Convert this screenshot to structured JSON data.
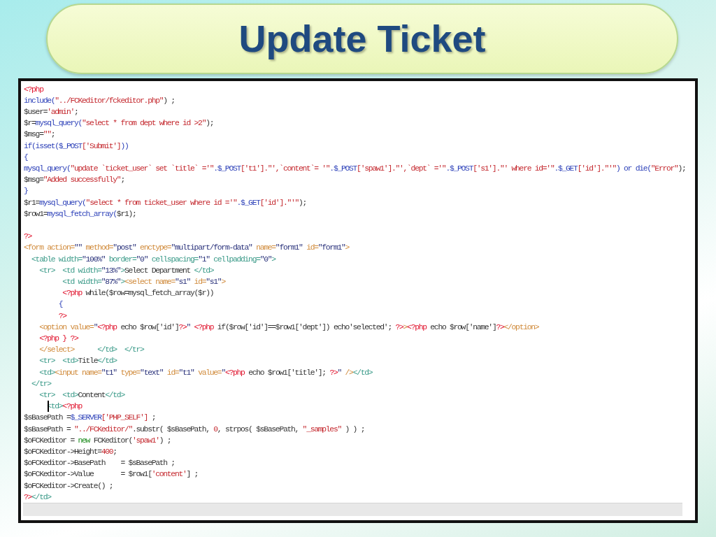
{
  "slide": {
    "title": "Update Ticket"
  },
  "code_lines": [
    {
      "segments": [
        {
          "text": "<?php",
          "kind": "php"
        }
      ]
    },
    {
      "segments": [
        {
          "text": "include(",
          "kind": "func"
        },
        {
          "text": "\"../FCKeditor/fckeditor.php\"",
          "kind": "string"
        },
        {
          "text": ") ;",
          "kind": "plain"
        }
      ]
    },
    {
      "segments": [
        {
          "text": "$user=",
          "kind": "plain"
        },
        {
          "text": "'admin'",
          "kind": "string"
        },
        {
          "text": ";",
          "kind": "plain"
        }
      ]
    },
    {
      "segments": [
        {
          "text": "$r=",
          "kind": "plain"
        },
        {
          "text": "mysql_query(",
          "kind": "func"
        },
        {
          "text": "\"select * from dept where id >2\"",
          "kind": "string"
        },
        {
          "text": ");",
          "kind": "plain"
        }
      ]
    },
    {
      "segments": [
        {
          "text": "$msg=",
          "kind": "plain"
        },
        {
          "text": "\"\"",
          "kind": "string"
        },
        {
          "text": ";",
          "kind": "plain"
        }
      ]
    },
    {
      "segments": [
        {
          "text": "if(isset(",
          "kind": "func"
        },
        {
          "text": "$_POST",
          "kind": "func"
        },
        {
          "text": "['Submit']",
          "kind": "string"
        },
        {
          "text": "))",
          "kind": "func"
        }
      ]
    },
    {
      "segments": [
        {
          "text": "{",
          "kind": "func"
        }
      ]
    },
    {
      "segments": [
        {
          "text": "mysql_query(",
          "kind": "func"
        },
        {
          "text": "\"update `ticket_user` set `title` ='\"",
          "kind": "string"
        },
        {
          "text": ".$_POST",
          "kind": "func"
        },
        {
          "text": "['t1'].\"',`content`= '\"",
          "kind": "string"
        },
        {
          "text": ".$_POST",
          "kind": "func"
        },
        {
          "text": "['spaw1'].\"',`dept` ='\"",
          "kind": "string"
        },
        {
          "text": ".$_POST",
          "kind": "func"
        },
        {
          "text": "['s1'].\"' where id='\"",
          "kind": "string"
        },
        {
          "text": ".$_GET",
          "kind": "func"
        },
        {
          "text": "['id'].\"'\"",
          "kind": "string"
        },
        {
          "text": ") or die(",
          "kind": "func"
        },
        {
          "text": "\"Error\"",
          "kind": "string"
        },
        {
          "text": ");",
          "kind": "plain"
        }
      ]
    },
    {
      "segments": [
        {
          "text": "$msg=",
          "kind": "plain"
        },
        {
          "text": "\"Added successfully\"",
          "kind": "string"
        },
        {
          "text": ";",
          "kind": "plain"
        }
      ]
    },
    {
      "segments": [
        {
          "text": "}",
          "kind": "func"
        }
      ]
    },
    {
      "segments": [
        {
          "text": "$r1=",
          "kind": "plain"
        },
        {
          "text": "mysql_query(",
          "kind": "func"
        },
        {
          "text": "\"select * from ticket_user where id ='\"",
          "kind": "string"
        },
        {
          "text": ".$_GET",
          "kind": "func"
        },
        {
          "text": "['id'].\"'\"",
          "kind": "string"
        },
        {
          "text": ");",
          "kind": "plain"
        }
      ]
    },
    {
      "segments": [
        {
          "text": "$row1=",
          "kind": "plain"
        },
        {
          "text": "mysql_fetch_array(",
          "kind": "func"
        },
        {
          "text": "$r1);",
          "kind": "plain"
        }
      ]
    },
    {
      "gap_before": true,
      "segments": [
        {
          "text": "?>",
          "kind": "php"
        }
      ]
    },
    {
      "segments": [
        {
          "text": "<form action=",
          "kind": "tag"
        },
        {
          "text": "\"\"",
          "kind": "value"
        },
        {
          "text": " method=",
          "kind": "tag"
        },
        {
          "text": "\"post\"",
          "kind": "value"
        },
        {
          "text": " enctype=",
          "kind": "tag"
        },
        {
          "text": "\"multipart/form-data\"",
          "kind": "value"
        },
        {
          "text": " name=",
          "kind": "tag"
        },
        {
          "text": "\"form1\"",
          "kind": "value"
        },
        {
          "text": " id=",
          "kind": "tag"
        },
        {
          "text": "\"form1\"",
          "kind": "value"
        },
        {
          "text": ">",
          "kind": "tag"
        }
      ]
    },
    {
      "segments": [
        {
          "text": "  <table width=",
          "kind": "tag2"
        },
        {
          "text": "\"100%\"",
          "kind": "value"
        },
        {
          "text": " border=",
          "kind": "tag2"
        },
        {
          "text": "\"0\"",
          "kind": "value"
        },
        {
          "text": " cellspacing=",
          "kind": "tag2"
        },
        {
          "text": "\"1\"",
          "kind": "value"
        },
        {
          "text": " cellpadding=",
          "kind": "tag2"
        },
        {
          "text": "\"0\"",
          "kind": "value"
        },
        {
          "text": ">",
          "kind": "tag2"
        }
      ]
    },
    {
      "segments": [
        {
          "text": "    <tr>  <td width=",
          "kind": "tag2"
        },
        {
          "text": "\"13%\"",
          "kind": "value"
        },
        {
          "text": ">",
          "kind": "tag2"
        },
        {
          "text": "Select Department ",
          "kind": "plain"
        },
        {
          "text": "</td>",
          "kind": "tag2"
        }
      ]
    },
    {
      "segments": [
        {
          "text": "          <td width=",
          "kind": "tag2"
        },
        {
          "text": "\"87%\"",
          "kind": "value"
        },
        {
          "text": ">",
          "kind": "tag2"
        },
        {
          "text": "<select name=",
          "kind": "tag"
        },
        {
          "text": "\"s1\"",
          "kind": "value"
        },
        {
          "text": " id=",
          "kind": "tag"
        },
        {
          "text": "\"s1\"",
          "kind": "value"
        },
        {
          "text": ">",
          "kind": "tag"
        }
      ]
    },
    {
      "segments": [
        {
          "text": "          <?php",
          "kind": "php"
        },
        {
          "text": " while($row=mysql_fetch_array($r))",
          "kind": "plain"
        }
      ]
    },
    {
      "segments": [
        {
          "text": "         {",
          "kind": "func"
        }
      ]
    },
    {
      "segments": [
        {
          "text": "         ?>",
          "kind": "php"
        }
      ]
    },
    {
      "segments": [
        {
          "text": "    <option value=",
          "kind": "tag"
        },
        {
          "text": "\"",
          "kind": "value"
        },
        {
          "text": "<?php",
          "kind": "php"
        },
        {
          "text": " echo $row['id']",
          "kind": "plain"
        },
        {
          "text": "?>",
          "kind": "php"
        },
        {
          "text": "\" ",
          "kind": "value"
        },
        {
          "text": "<?php",
          "kind": "php"
        },
        {
          "text": " if($row['id']==$row1['dept']) echo'selected'; ",
          "kind": "plain"
        },
        {
          "text": "?>",
          "kind": "php"
        },
        {
          "text": ">",
          "kind": "tag"
        },
        {
          "text": "<?php",
          "kind": "php"
        },
        {
          "text": " echo $row['name']",
          "kind": "plain"
        },
        {
          "text": "?>",
          "kind": "php"
        },
        {
          "text": "</option>",
          "kind": "tag"
        }
      ]
    },
    {
      "segments": [
        {
          "text": "    <?php } ?>",
          "kind": "php"
        }
      ]
    },
    {
      "segments": [
        {
          "text": "    </select>",
          "kind": "tag"
        },
        {
          "text": "      </td>  </tr>",
          "kind": "tag2"
        }
      ]
    },
    {
      "segments": [
        {
          "text": "    <tr>  <td>",
          "kind": "tag2"
        },
        {
          "text": "Title",
          "kind": "plain"
        },
        {
          "text": "</td>",
          "kind": "tag2"
        }
      ]
    },
    {
      "segments": [
        {
          "text": "    <td>",
          "kind": "tag2"
        },
        {
          "text": "<input name=",
          "kind": "tag"
        },
        {
          "text": "\"t1\"",
          "kind": "value"
        },
        {
          "text": " type=",
          "kind": "tag"
        },
        {
          "text": "\"text\"",
          "kind": "value"
        },
        {
          "text": " id=",
          "kind": "tag"
        },
        {
          "text": "\"t1\"",
          "kind": "value"
        },
        {
          "text": " value=",
          "kind": "tag"
        },
        {
          "text": "\"",
          "kind": "value"
        },
        {
          "text": "<?php",
          "kind": "php"
        },
        {
          "text": " echo $row1['title']; ",
          "kind": "plain"
        },
        {
          "text": "?>",
          "kind": "php"
        },
        {
          "text": "\"",
          "kind": "value"
        },
        {
          "text": " />",
          "kind": "tag"
        },
        {
          "text": "</td>",
          "kind": "tag2"
        }
      ]
    },
    {
      "segments": [
        {
          "text": "  </tr>",
          "kind": "tag2"
        }
      ]
    },
    {
      "segments": [
        {
          "text": "    <tr>  <td>",
          "kind": "tag2"
        },
        {
          "text": "Content",
          "kind": "plain"
        },
        {
          "text": "</td>",
          "kind": "tag2"
        }
      ]
    },
    {
      "caret": true,
      "segments": [
        {
          "text": "      <td>",
          "kind": "tag2"
        },
        {
          "text": "<?php",
          "kind": "php"
        }
      ]
    },
    {
      "segments": [
        {
          "text": "$sBasePath =",
          "kind": "plain"
        },
        {
          "text": "$_SERVER",
          "kind": "func"
        },
        {
          "text": "['PHP_SELF']",
          "kind": "string"
        },
        {
          "text": " ;",
          "kind": "plain"
        }
      ]
    },
    {
      "segments": [
        {
          "text": "$sBasePath = ",
          "kind": "plain"
        },
        {
          "text": "\"../FCKeditor/\"",
          "kind": "string"
        },
        {
          "text": ".substr( $sBasePath, ",
          "kind": "plain"
        },
        {
          "text": "0",
          "kind": "string"
        },
        {
          "text": ", strpos( $sBasePath, ",
          "kind": "plain"
        },
        {
          "text": "\"_samples\"",
          "kind": "string"
        },
        {
          "text": " ) ) ;",
          "kind": "plain"
        }
      ]
    },
    {
      "segments": [
        {
          "text": "$oFCKeditor = ",
          "kind": "plain"
        },
        {
          "text": "new",
          "kind": "keyword"
        },
        {
          "text": " FCKeditor(",
          "kind": "plain"
        },
        {
          "text": "'spaw1'",
          "kind": "string"
        },
        {
          "text": ") ;",
          "kind": "plain"
        }
      ]
    },
    {
      "segments": [
        {
          "text": "$oFCKeditor->Height=",
          "kind": "plain"
        },
        {
          "text": "400",
          "kind": "string"
        },
        {
          "text": ";",
          "kind": "plain"
        }
      ]
    },
    {
      "segments": [
        {
          "text": "$oFCKeditor->BasePath    = $sBasePath ;",
          "kind": "plain"
        }
      ]
    },
    {
      "segments": [
        {
          "text": "$oFCKeditor->Value       = $row1[",
          "kind": "plain"
        },
        {
          "text": "'content'",
          "kind": "string"
        },
        {
          "text": "] ;",
          "kind": "plain"
        }
      ]
    },
    {
      "segments": [
        {
          "text": "$oFCKeditor->Create() ;",
          "kind": "plain"
        }
      ]
    },
    {
      "segments": [
        {
          "text": "?>",
          "kind": "php"
        },
        {
          "text": "</td>",
          "kind": "tag2"
        }
      ]
    }
  ]
}
